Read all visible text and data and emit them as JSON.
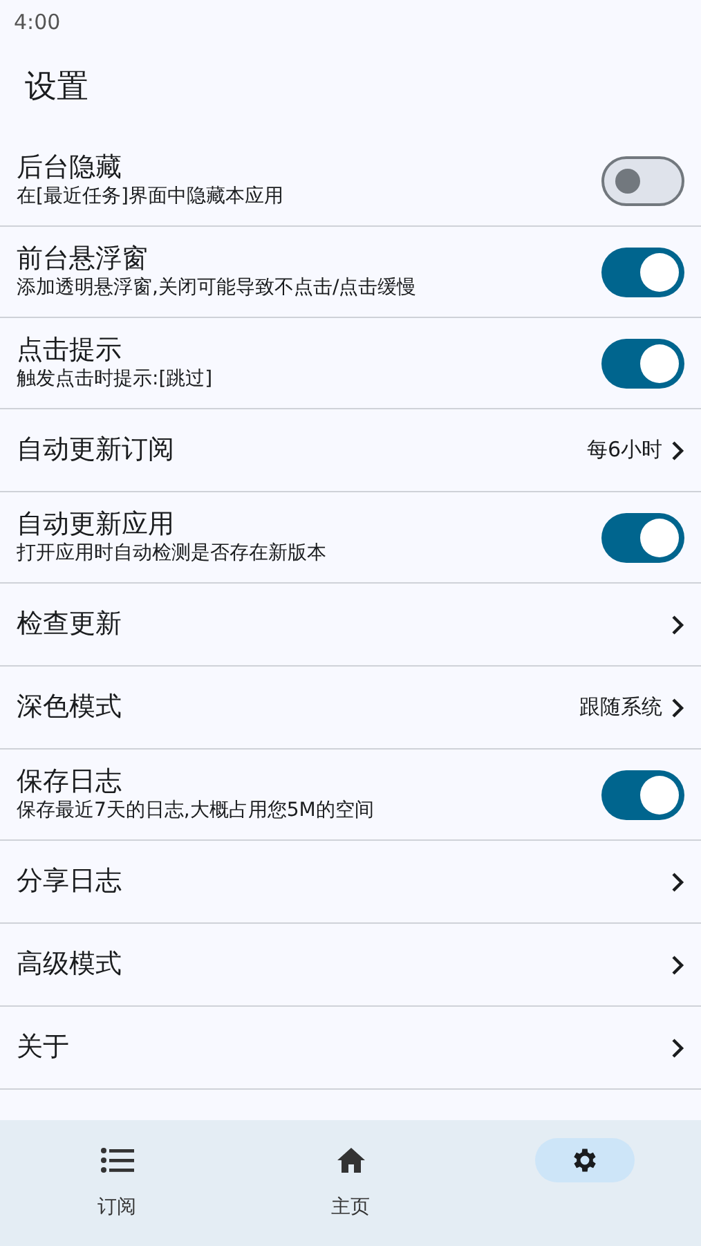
{
  "status_bar": {
    "time": "4:00"
  },
  "title": "设置",
  "settings": [
    {
      "kind": "toggle",
      "title": "后台隐藏",
      "subtitle": "在[最近任务]界面中隐藏本应用",
      "on": false
    },
    {
      "kind": "toggle",
      "title": "前台悬浮窗",
      "subtitle": "添加透明悬浮窗,关闭可能导致不点击/点击缓慢",
      "on": true
    },
    {
      "kind": "toggle",
      "title": "点击提示",
      "subtitle": "触发点击时提示:[跳过]",
      "on": true
    },
    {
      "kind": "link",
      "title": "自动更新订阅",
      "value": "每6小时"
    },
    {
      "kind": "toggle",
      "title": "自动更新应用",
      "subtitle": "打开应用时自动检测是否存在新版本",
      "on": true
    },
    {
      "kind": "link",
      "title": "检查更新"
    },
    {
      "kind": "link",
      "title": "深色模式",
      "value": "跟随系统"
    },
    {
      "kind": "toggle",
      "title": "保存日志",
      "subtitle": "保存最近7天的日志,大概占用您5M的空间",
      "on": true
    },
    {
      "kind": "link",
      "title": "分享日志"
    },
    {
      "kind": "link",
      "title": "高级模式"
    },
    {
      "kind": "link",
      "title": "关于"
    }
  ],
  "bottom_nav": [
    {
      "kind": "list",
      "label": "订阅",
      "selected": false
    },
    {
      "kind": "home",
      "label": "主页",
      "selected": false
    },
    {
      "kind": "settings",
      "selected": true
    }
  ]
}
